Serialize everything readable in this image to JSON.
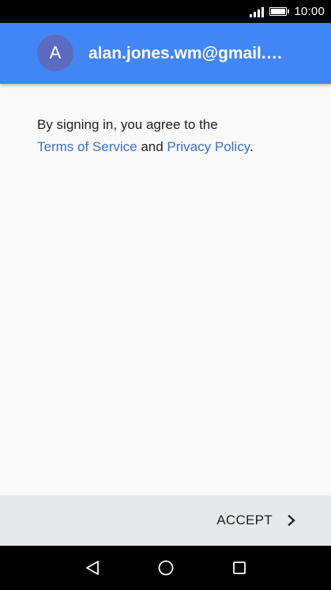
{
  "status_bar": {
    "time": "10:00",
    "signal_icon": "signal-icon",
    "battery_icon": "battery-icon"
  },
  "header": {
    "avatar_letter": "A",
    "email": "alan.jones.wm@gmail.…",
    "background_color": "#4285f4",
    "avatar_color": "#5c6bc0"
  },
  "terms": {
    "line1": "By signing in, you agree to the",
    "terms_link": "Terms of Service",
    "and": " and ",
    "privacy_link": "Privacy Policy",
    "period": ".",
    "link_color": "#3f6fc6"
  },
  "action_bar": {
    "accept_label": "ACCEPT",
    "accept_icon": "chevron-right-icon"
  },
  "nav_bar": {
    "back_icon": "back-triangle-icon",
    "home_icon": "home-circle-icon",
    "recent_icon": "recent-apps-square-icon"
  }
}
